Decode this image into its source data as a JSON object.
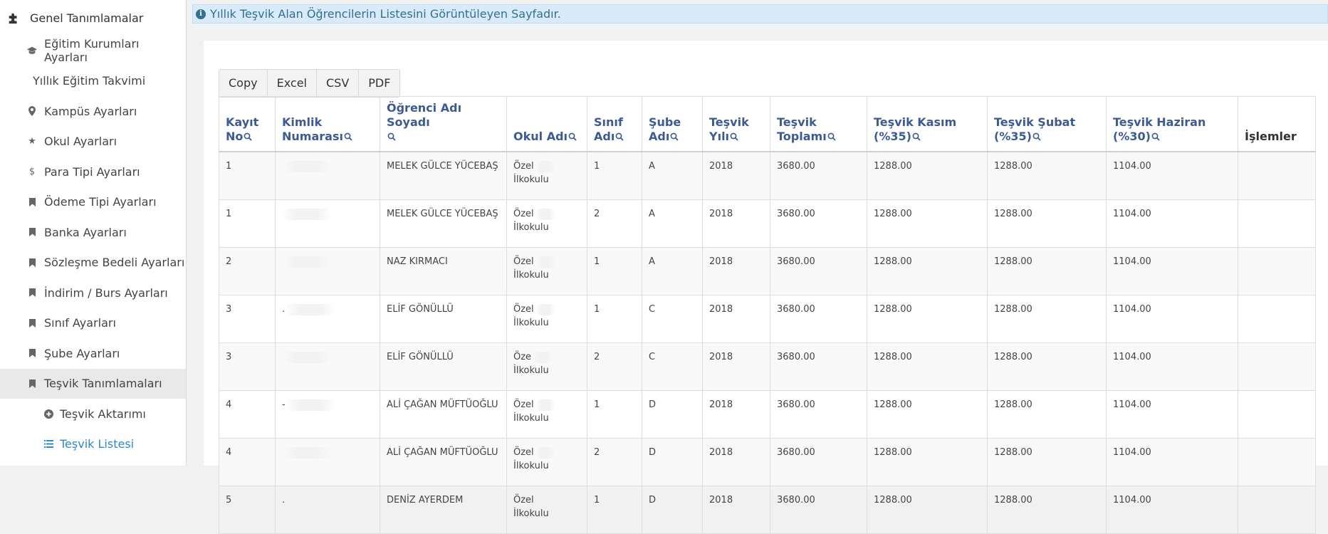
{
  "sidebar": {
    "header": "Genel Tanımlamalar",
    "items": [
      {
        "label": "Eğitim Kurumları Ayarları",
        "icon": "graduation-cap-icon"
      },
      {
        "label": "Yıllık Eğitim Takvimi",
        "icon": ""
      },
      {
        "label": "Kampüs Ayarları",
        "icon": "map-marker-icon"
      },
      {
        "label": "Okul Ayarları",
        "icon": "star-icon"
      },
      {
        "label": "Para Tipi Ayarları",
        "icon": "dollar-icon"
      },
      {
        "label": "Ödeme Tipi Ayarları",
        "icon": "bookmark-icon"
      },
      {
        "label": "Banka Ayarları",
        "icon": "bookmark-icon"
      },
      {
        "label": "Sözleşme Bedeli Ayarları",
        "icon": "bookmark-icon"
      },
      {
        "label": "İndirim / Burs Ayarları",
        "icon": "bookmark-icon"
      },
      {
        "label": "Sınıf Ayarları",
        "icon": "bookmark-icon"
      },
      {
        "label": "Şube Ayarları",
        "icon": "bookmark-icon"
      },
      {
        "label": "Teşvik Tanımlamaları",
        "icon": "bookmark-icon"
      }
    ],
    "subitems": [
      {
        "label": "Teşvik Aktarımı",
        "icon": "plus-circle-icon"
      },
      {
        "label": "Teşvik Listesi",
        "icon": "list-icon"
      }
    ]
  },
  "info": {
    "text": "Yıllık Teşvik Alan Öğrencilerin Listesini Görüntüleyen Sayfadır."
  },
  "buttons": {
    "copy": "Copy",
    "excel": "Excel",
    "csv": "CSV",
    "pdf": "PDF"
  },
  "table": {
    "headers": [
      {
        "line1": "Kayıt",
        "line2": "No"
      },
      {
        "line1": "Kimlik",
        "line2": "Numarası"
      },
      {
        "line1": "Öğrenci Adı Soyadı",
        "line2": ""
      },
      {
        "line1": "",
        "line2": "Okul Adı"
      },
      {
        "line1": "Sınıf",
        "line2": "Adı"
      },
      {
        "line1": "Şube",
        "line2": "Adı"
      },
      {
        "line1": "Teşvik",
        "line2": "Yılı"
      },
      {
        "line1": "Teşvik",
        "line2": "Toplamı"
      },
      {
        "line1": "Teşvik Kasım",
        "line2": "(%35)"
      },
      {
        "line1": "Teşvik Şubat",
        "line2": "(%35)"
      },
      {
        "line1": "Teşvik Haziran",
        "line2": "(%30)"
      },
      {
        "line1": "",
        "line2": "İşlemler"
      }
    ],
    "rows": [
      {
        "kayit": "1",
        "kimlik": "",
        "ad": "MELEK GÜLCE YÜCEBAŞ",
        "okul1": "Özel",
        "okul2": "İlkokulu",
        "sinif": "1",
        "sube": "A",
        "yil": "2018",
        "toplam": "3680.00",
        "kasim": "1288.00",
        "subat": "1288.00",
        "haziran": "1104.00"
      },
      {
        "kayit": "1",
        "kimlik": "",
        "ad": "MELEK GÜLCE YÜCEBAŞ",
        "okul1": "Özel",
        "okul2": "İlkokulu",
        "sinif": "2",
        "sube": "A",
        "yil": "2018",
        "toplam": "3680.00",
        "kasim": "1288.00",
        "subat": "1288.00",
        "haziran": "1104.00"
      },
      {
        "kayit": "2",
        "kimlik": "",
        "ad": "NAZ KIRMACI",
        "okul1": "Özel",
        "okul2": "İlkokulu",
        "sinif": "1",
        "sube": "A",
        "yil": "2018",
        "toplam": "3680.00",
        "kasim": "1288.00",
        "subat": "1288.00",
        "haziran": "1104.00"
      },
      {
        "kayit": "3",
        "kimlik": ".",
        "ad": "ELİF GÖNÜLLÜ",
        "okul1": "Özel",
        "okul2": "İlkokulu",
        "sinif": "1",
        "sube": "C",
        "yil": "2018",
        "toplam": "3680.00",
        "kasim": "1288.00",
        "subat": "1288.00",
        "haziran": "1104.00"
      },
      {
        "kayit": "3",
        "kimlik": "",
        "ad": "ELİF GÖNÜLLÜ",
        "okul1": "Öze",
        "okul2": "İlkokulu",
        "sinif": "2",
        "sube": "C",
        "yil": "2018",
        "toplam": "3680.00",
        "kasim": "1288.00",
        "subat": "1288.00",
        "haziran": "1104.00"
      },
      {
        "kayit": "4",
        "kimlik": "-",
        "ad": "ALİ ÇAĞAN MÜFTÜOĞLU",
        "okul1": "Özel",
        "okul2": "İlkokulu",
        "sinif": "1",
        "sube": "D",
        "yil": "2018",
        "toplam": "3680.00",
        "kasim": "1288.00",
        "subat": "1288.00",
        "haziran": "1104.00"
      },
      {
        "kayit": "4",
        "kimlik": "",
        "ad": "ALİ ÇAĞAN MÜFTÜOĞLU",
        "okul1": "Özel",
        "okul2": "İlkokulu",
        "sinif": "2",
        "sube": "D",
        "yil": "2018",
        "toplam": "3680.00",
        "kasim": "1288.00",
        "subat": "1288.00",
        "haziran": "1104.00"
      },
      {
        "kayit": "5",
        "kimlik": ".",
        "ad": "DENİZ AYERDEM",
        "okul1": "Özel",
        "okul2": "İlkokulu",
        "sinif": "1",
        "sube": "D",
        "yil": "2018",
        "toplam": "3680.00",
        "kasim": "1288.00",
        "subat": "1288.00",
        "haziran": "1104.00"
      }
    ]
  }
}
